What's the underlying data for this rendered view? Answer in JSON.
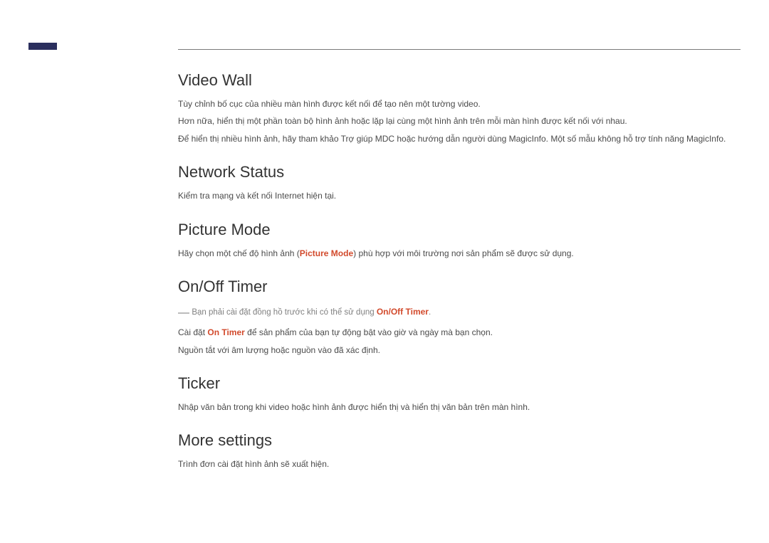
{
  "sections": {
    "videoWall": {
      "heading": "Video Wall",
      "p1": "Tùy chỉnh bố cục của nhiều màn hình được kết nối để tạo nên một tường video.",
      "p2": "Hơn nữa, hiển thị một phần toàn bộ hình ảnh hoặc lặp lại cùng một hình ảnh trên mỗi màn hình được kết nối với nhau.",
      "p3": "Để hiển thị nhiều hình ảnh, hãy tham khảo Trợ giúp MDC hoặc hướng dẫn người dùng MagicInfo. Một số mẫu không hỗ trợ tính năng MagicInfo."
    },
    "networkStatus": {
      "heading": "Network Status",
      "p1": "Kiểm tra mạng và kết nối Internet hiện tại."
    },
    "pictureMode": {
      "heading": "Picture Mode",
      "p1_prefix": "Hãy chọn một chế độ hình ảnh (",
      "p1_em": "Picture Mode",
      "p1_suffix": ") phù hợp với môi trường nơi sản phẩm sẽ được sử dụng."
    },
    "onOffTimer": {
      "heading": "On/Off Timer",
      "note_prefix": "Bạn phải cài đặt đồng hồ trước khi có thể sử dụng ",
      "note_em": "On/Off Timer",
      "note_suffix": ".",
      "p2_prefix": "Cài đặt ",
      "p2_em": "On Timer",
      "p2_suffix": " để sản phẩm của bạn tự động bật vào giờ và ngày mà bạn chọn.",
      "p3": "Nguồn tắt với âm lượng hoặc nguồn vào đã xác định."
    },
    "ticker": {
      "heading": "Ticker",
      "p1": "Nhập văn bản trong khi video hoặc hình ảnh được hiển thị và hiển thị văn bản trên màn hình."
    },
    "moreSettings": {
      "heading": "More settings",
      "p1": "Trình đơn cài đặt hình ảnh sẽ xuất hiện."
    }
  }
}
